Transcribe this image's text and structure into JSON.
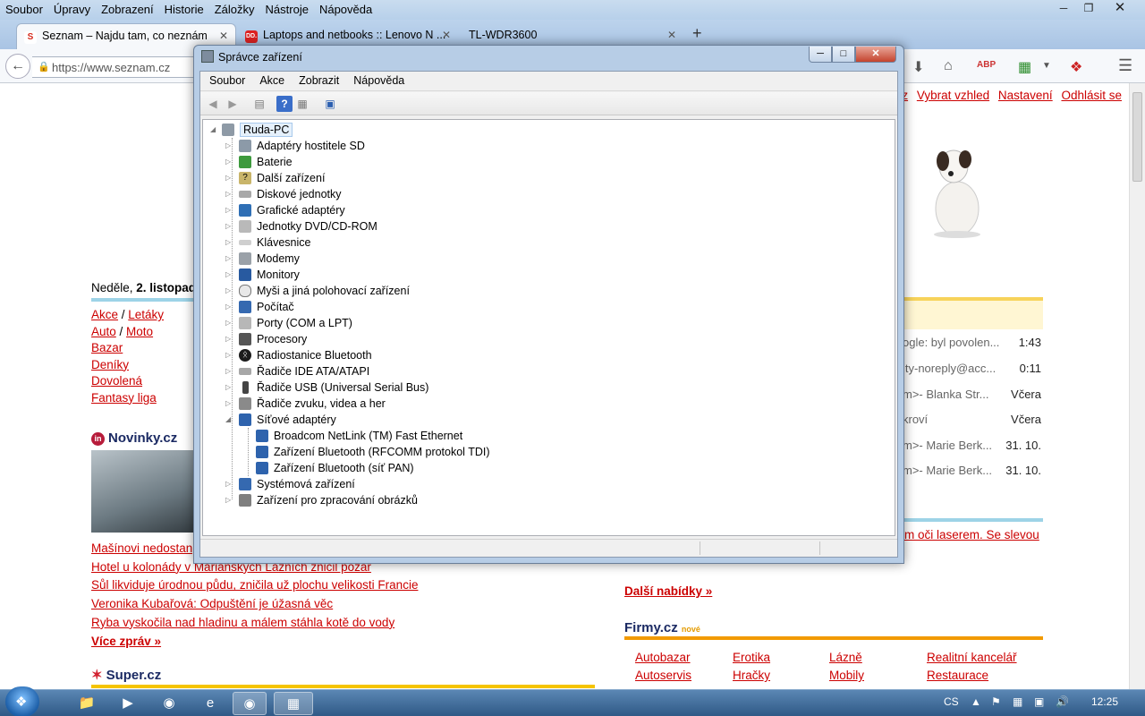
{
  "browser": {
    "menu": [
      "Soubor",
      "Úpravy",
      "Zobrazení",
      "Historie",
      "Záložky",
      "Nástroje",
      "Nápověda"
    ],
    "tabs": [
      {
        "label": "Seznam – Najdu tam, co neznám",
        "favicon": "seznam-icon",
        "fav_text": "S"
      },
      {
        "label": "Laptops and netbooks :: Lenovo N ...",
        "favicon": "lenovo-icon",
        "fav_text": "DD."
      },
      {
        "label": "TL-WDR3600",
        "favicon": "none",
        "fav_text": ""
      }
    ],
    "url": "https://www.seznam.cz",
    "toolbar_icons": [
      "download-icon",
      "home-icon",
      "adblock-icon",
      "addon-icon",
      "extension-icon",
      "menu-icon"
    ]
  },
  "page": {
    "top_links": [
      "cz",
      "Vybrat vzhled",
      "Nastavení",
      "Odhlásit se"
    ],
    "date_prefix": "Neděle, ",
    "date_bold": "2. listopad",
    "categories": [
      [
        "Akce",
        "Letáky"
      ],
      [
        "Auto",
        "Moto"
      ],
      [
        "Bazar"
      ],
      [
        "Deníky"
      ],
      [
        "Dovolená"
      ],
      [
        "Fantasy liga"
      ]
    ],
    "separator": " / ",
    "novinky_title": "Novinky.cz",
    "novinky_logo": "in",
    "news": [
      "Mašínovi nedostang",
      "Hotel u kolonády v Mariánských Lázních zničil požár",
      "Sůl likviduje úrodnou půdu, zničila už plochu velikosti Francie",
      "Veronika Kubařová: Odpuštění je úžasná věc",
      "Ryba vyskočila nad hladinu a málem stáhla kotě do vody"
    ],
    "more_news": "Více zpráv »",
    "super_title": "Super.cz",
    "mail": [
      {
        "text": "ogle: byl povolen...",
        "time": "1:43"
      },
      {
        "text": "ity-noreply@acc...",
        "time": "0:11"
      },
      {
        "text": "m>- Blanka Str...",
        "time": "Včera"
      },
      {
        "text": "kroví",
        "time": "Včera"
      },
      {
        "text": "m>- Marie Berk...",
        "time": "31. 10."
      },
      {
        "text": "m>- Marie Berk...",
        "time": "31. 10."
      }
    ],
    "ad_link": "m oči laserem. Se slevou",
    "more_offers": "Další nabídky »",
    "firmy_title": "Firmy.cz",
    "firmy_new": "nové",
    "firmy_links": [
      "Autobazar",
      "Erotika",
      "Lázně",
      "Realitní kancelář",
      "Autoservis",
      "Hračky",
      "Mobily",
      "Restaurace"
    ]
  },
  "device_manager": {
    "title": "Správce zařízení",
    "menu": [
      "Soubor",
      "Akce",
      "Zobrazit",
      "Nápověda"
    ],
    "root": "Ruda-PC",
    "categories": [
      {
        "label": "Adaptéry hostitele SD",
        "icon": "sd-host-icon"
      },
      {
        "label": "Baterie",
        "icon": "battery-icon"
      },
      {
        "label": "Další zařízení",
        "icon": "unknown-device-icon"
      },
      {
        "label": "Diskové jednotky",
        "icon": "disk-icon"
      },
      {
        "label": "Grafické adaptéry",
        "icon": "display-adapter-icon"
      },
      {
        "label": "Jednotky DVD/CD-ROM",
        "icon": "dvd-icon"
      },
      {
        "label": "Klávesnice",
        "icon": "keyboard-icon"
      },
      {
        "label": "Modemy",
        "icon": "modem-icon"
      },
      {
        "label": "Monitory",
        "icon": "monitor-icon"
      },
      {
        "label": "Myši a jiná polohovací zařízení",
        "icon": "mouse-icon"
      },
      {
        "label": "Počítač",
        "icon": "computer-icon"
      },
      {
        "label": "Porty (COM a LPT)",
        "icon": "port-icon"
      },
      {
        "label": "Procesory",
        "icon": "processor-icon"
      },
      {
        "label": "Radiostanice Bluetooth",
        "icon": "bluetooth-icon"
      },
      {
        "label": "Řadiče IDE ATA/ATAPI",
        "icon": "ide-icon"
      },
      {
        "label": "Řadiče USB (Universal Serial Bus)",
        "icon": "usb-icon"
      },
      {
        "label": "Řadiče zvuku, videa a her",
        "icon": "sound-icon"
      },
      {
        "label": "Síťové adaptéry",
        "icon": "network-icon",
        "expanded": true
      }
    ],
    "network_children": [
      "Broadcom NetLink (TM) Fast Ethernet",
      "Zařízení Bluetooth (RFCOMM protokol TDI)",
      "Zařízení Bluetooth (síť PAN)"
    ],
    "categories_after": [
      {
        "label": "Systémová zařízení",
        "icon": "system-icon"
      },
      {
        "label": "Zařízení pro zpracování obrázků",
        "icon": "imaging-icon"
      }
    ]
  },
  "taskbar": {
    "language": "CS",
    "clock": "12:25"
  }
}
